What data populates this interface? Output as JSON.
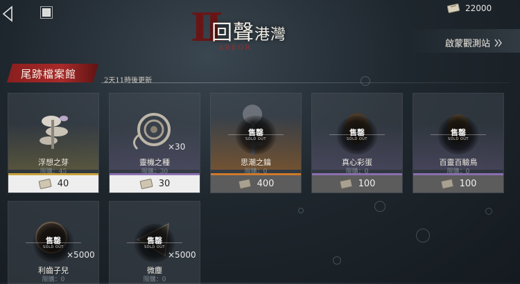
{
  "header": {
    "title_roman": "II",
    "title_main": "回聲",
    "title_small": "港灣",
    "title_sub": "ARBOR",
    "currency_amount": "22000",
    "observatory_label": "啟蒙觀測站"
  },
  "section": {
    "tab_label": "尾跡檔案館",
    "refresh_text": "2天11時後更新"
  },
  "soldout": {
    "cn": "售罄",
    "en": "SOLD OUT"
  },
  "items": [
    {
      "name": "浮想之芽",
      "limit": "限購：45",
      "price": "40",
      "qty": "",
      "sold_out": false,
      "rarity_color": "#c8a23a",
      "price_style": "light"
    },
    {
      "name": "靈機之種",
      "limit": "限購：30",
      "price": "30",
      "qty": "×30",
      "sold_out": false,
      "rarity_color": "#8a6fb0",
      "price_style": "light"
    },
    {
      "name": "思潮之鑰",
      "limit": "限購：0",
      "price": "400",
      "qty": "",
      "sold_out": true,
      "rarity_color": "#d07a2a",
      "price_style": "dark"
    },
    {
      "name": "真心彩蛋",
      "limit": "限購：0",
      "price": "100",
      "qty": "",
      "sold_out": true,
      "rarity_color": "#8a6fb0",
      "price_style": "dark"
    },
    {
      "name": "百靈百驗鳥",
      "limit": "限購：0",
      "price": "100",
      "qty": "",
      "sold_out": true,
      "rarity_color": "#8a6fb0",
      "price_style": "dark"
    },
    {
      "name": "利齒子兒",
      "limit": "限購：0",
      "price": "",
      "qty": "×5000",
      "sold_out": true,
      "rarity_color": "",
      "price_style": "none"
    },
    {
      "name": "微塵",
      "limit": "限購：0",
      "price": "",
      "qty": "×5000",
      "sold_out": true,
      "rarity_color": "",
      "price_style": "none"
    }
  ],
  "colors": {
    "accent_red": "#a82a2a",
    "gold": "#c8a23a",
    "purple": "#8a6fb0",
    "orange": "#d07a2a"
  },
  "icons": [
    "back-arrow-icon",
    "home-icon",
    "ticket-icon",
    "chevron-double-right-icon"
  ]
}
